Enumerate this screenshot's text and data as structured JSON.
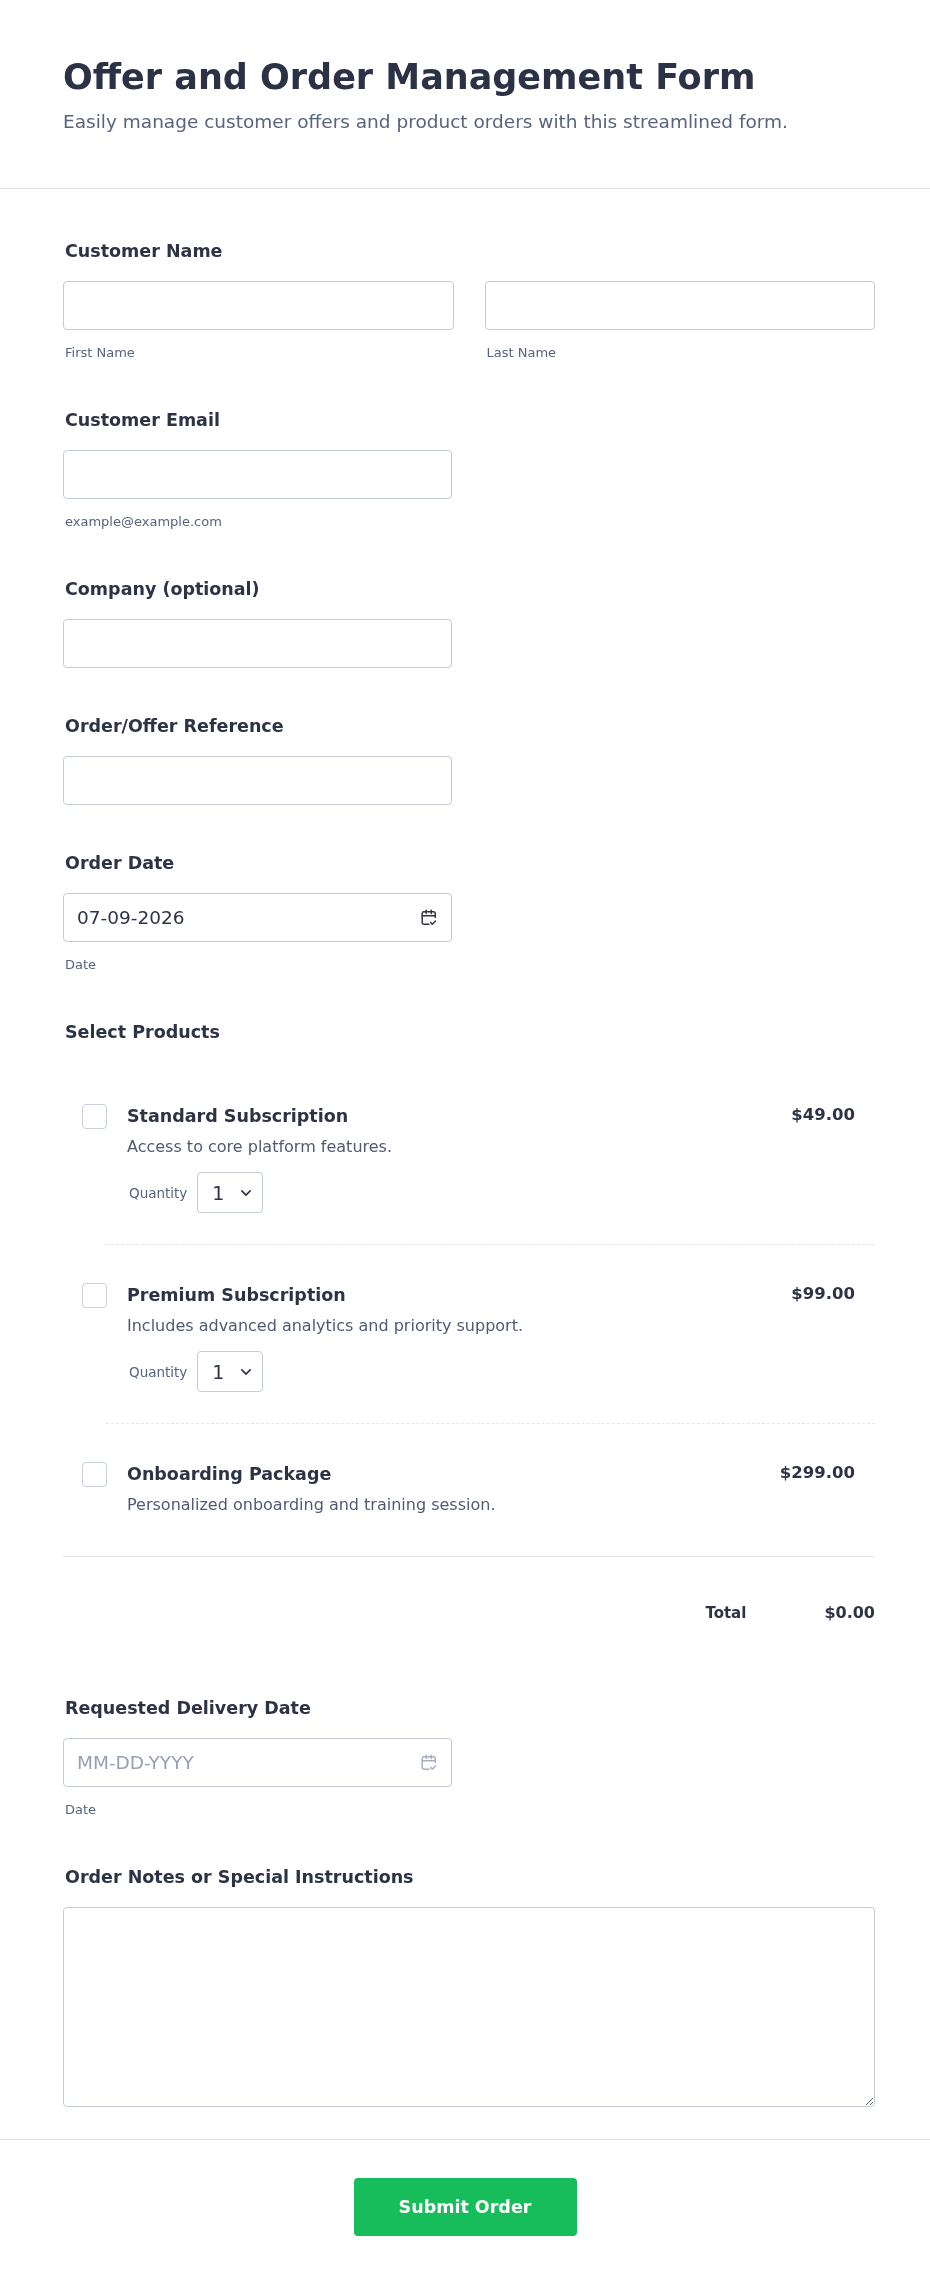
{
  "header": {
    "title": "Offer and Order Management Form",
    "subtitle": "Easily manage customer offers and product orders with this streamlined form."
  },
  "fields": [
    {
      "kind": "name",
      "label": "Customer Name",
      "parts": [
        {
          "sublabel": "First Name"
        },
        {
          "sublabel": "Last Name"
        }
      ]
    },
    {
      "kind": "text",
      "label": "Customer Email",
      "sublabel": "example@example.com"
    },
    {
      "kind": "text",
      "label": "Company (optional)"
    },
    {
      "kind": "text",
      "label": "Order/Offer Reference"
    },
    {
      "kind": "date",
      "label": "Order Date",
      "value": "07-09-2026",
      "sublabel": "Date"
    },
    {
      "kind": "products",
      "label": "Select Products",
      "items": [
        {
          "name": "Standard Subscription",
          "description": "Access to core platform features.",
          "price": "$49.00",
          "checked": false,
          "quantity_label": "Quantity",
          "quantity": "1"
        },
        {
          "name": "Premium Subscription",
          "description": "Includes advanced analytics and priority support.",
          "price": "$99.00",
          "checked": false,
          "quantity_label": "Quantity",
          "quantity": "1"
        },
        {
          "name": "Onboarding Package",
          "description": "Personalized onboarding and training session.",
          "price": "$299.00",
          "checked": false
        }
      ],
      "total_label": "Total",
      "total": "$0.00"
    },
    {
      "kind": "date",
      "label": "Requested Delivery Date",
      "placeholder": "MM-DD-YYYY",
      "sublabel": "Date"
    },
    {
      "kind": "textarea",
      "label": "Order Notes or Special Instructions"
    }
  ],
  "submit": {
    "label": "Submit Order"
  }
}
